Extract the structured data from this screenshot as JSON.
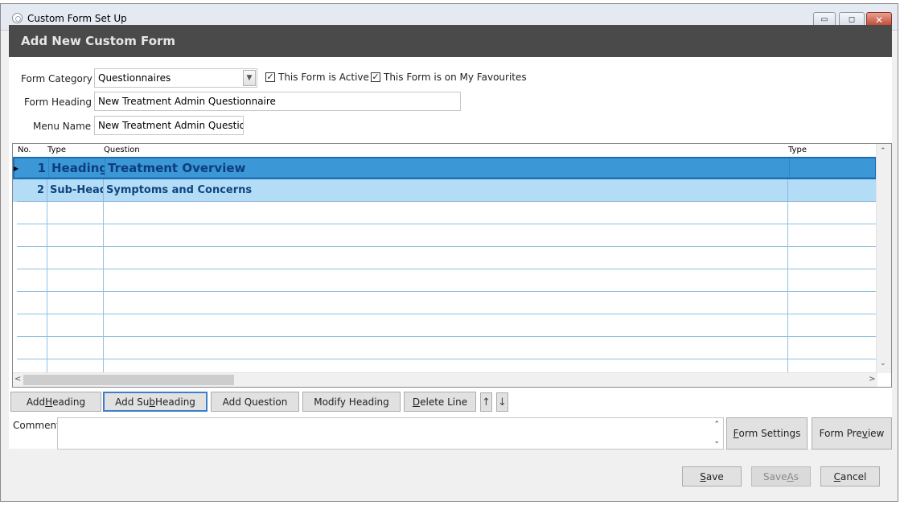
{
  "window": {
    "title": "Custom Form Set Up",
    "minimize": "▭",
    "restore": "◻",
    "close": "✕"
  },
  "header": {
    "title": "Add New Custom Form"
  },
  "form": {
    "category_label": "Form Category",
    "category_value": "Questionnaires",
    "active_label": "This Form is Active",
    "active_checked": true,
    "favourites_label": "This Form is on My Favourites",
    "favourites_checked": true,
    "heading_label": "Form Heading",
    "heading_value": "New Treatment Admin Questionnaire",
    "menu_label": "Menu Name",
    "menu_value": "New Treatment Admin Questio"
  },
  "grid": {
    "columns": [
      "No.",
      "Type",
      "Question",
      "Type"
    ],
    "rows": [
      {
        "no": "1",
        "type": "Heading",
        "question": "Treatment Overview",
        "type2": ""
      },
      {
        "no": "2",
        "type": "Sub-Headi",
        "question": "Symptoms and Concerns",
        "type2": ""
      }
    ],
    "empty_rows": 8
  },
  "buttons": {
    "add_heading": {
      "pre": "Add ",
      "key": "H",
      "post": "eading"
    },
    "add_sub_heading": {
      "pre": "Add Su",
      "key": "b",
      "post": " Heading"
    },
    "add_question": "Add Question",
    "modify_heading": "Modify Heading",
    "delete_line": {
      "pre": "",
      "key": "D",
      "post": "elete Line"
    },
    "move_up": "↑",
    "move_down": "↓",
    "form_settings": {
      "pre": "",
      "key": "F",
      "post": "orm Settings"
    },
    "form_preview": {
      "pre": "Form Pre",
      "key": "v",
      "post": "iew"
    },
    "save": {
      "pre": "",
      "key": "S",
      "post": "ave"
    },
    "save_as": {
      "pre": "Save ",
      "key": "A",
      "post": "s"
    },
    "cancel": {
      "pre": "",
      "key": "C",
      "post": "ancel"
    }
  },
  "comments": {
    "label": "Comments",
    "value": ""
  }
}
